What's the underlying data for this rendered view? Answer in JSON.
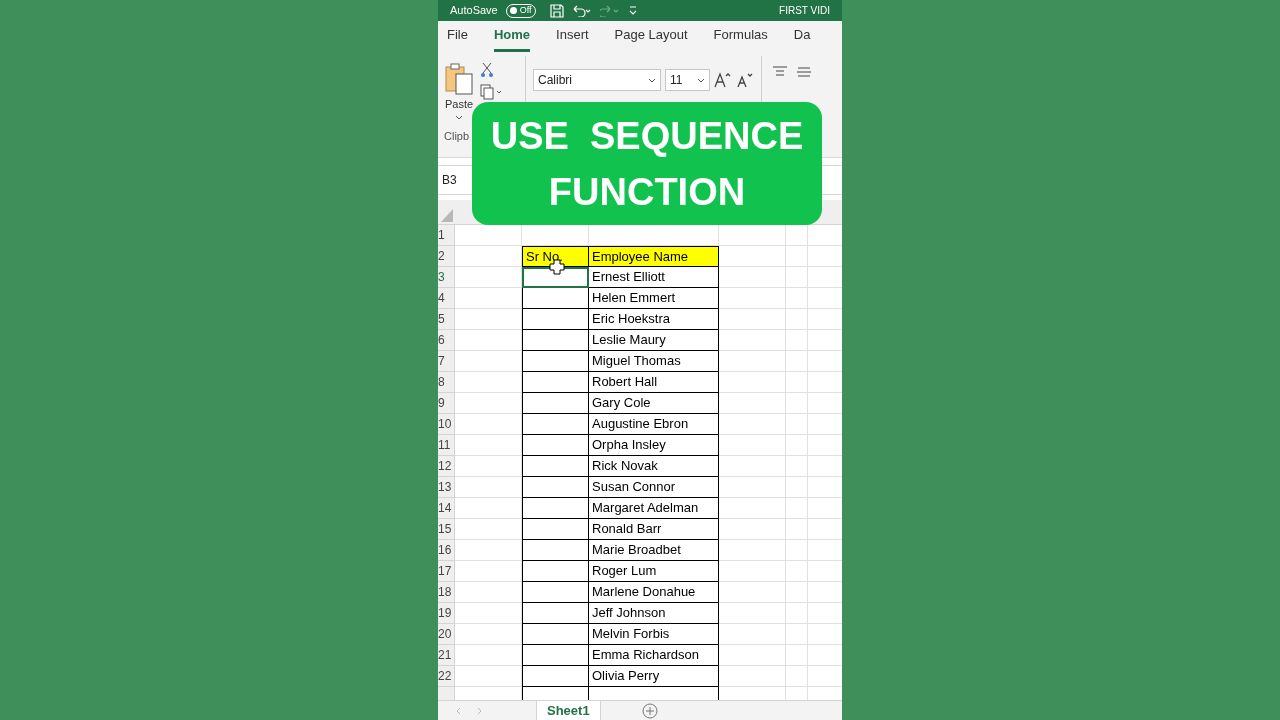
{
  "title_bar": {
    "autosave_label": "AutoSave",
    "autosave_toggle": {
      "label": "Off",
      "on": false
    },
    "document_title": "FIRST VIDI"
  },
  "ribbon_tabs": [
    {
      "label": "File",
      "selected": false
    },
    {
      "label": "Home",
      "selected": true
    },
    {
      "label": "Insert",
      "selected": false
    },
    {
      "label": "Page Layout",
      "selected": false
    },
    {
      "label": "Formulas",
      "selected": false
    },
    {
      "label": "Da",
      "selected": false
    }
  ],
  "ribbon": {
    "paste_label": "Paste",
    "group_label": "Clipb",
    "font": "Calibri",
    "font_size": "11"
  },
  "name_box": "B3",
  "overlay": {
    "lines": [
      "USE  SEQUENCE",
      "FUNCTION"
    ]
  },
  "sheet": {
    "first_row": {
      "number": "1"
    },
    "header_row": {
      "number": "2",
      "sr_no": "Sr No.",
      "name": "Employee Name"
    },
    "rows": [
      {
        "number": "3",
        "name": "Ernest Elliott",
        "selected": true
      },
      {
        "number": "4",
        "name": "Helen Emmert",
        "selected": false
      },
      {
        "number": "5",
        "name": "Eric Hoekstra",
        "selected": false
      },
      {
        "number": "6",
        "name": "Leslie Maury",
        "selected": false
      },
      {
        "number": "7",
        "name": "Miguel Thomas",
        "selected": false
      },
      {
        "number": "8",
        "name": "Robert Hall",
        "selected": false
      },
      {
        "number": "9",
        "name": "Gary Cole",
        "selected": false
      },
      {
        "number": "10",
        "name": "Augustine Ebron",
        "selected": false
      },
      {
        "number": "11",
        "name": "Orpha Insley",
        "selected": false
      },
      {
        "number": "12",
        "name": "Rick Novak",
        "selected": false
      },
      {
        "number": "13",
        "name": "Susan Connor",
        "selected": false
      },
      {
        "number": "14",
        "name": "Margaret Adelman",
        "selected": false
      },
      {
        "number": "15",
        "name": "Ronald Barr",
        "selected": false
      },
      {
        "number": "16",
        "name": "Marie Broadbet",
        "selected": false
      },
      {
        "number": "17",
        "name": "Roger Lum",
        "selected": false
      },
      {
        "number": "18",
        "name": "Marlene Donahue",
        "selected": false
      },
      {
        "number": "19",
        "name": "Jeff Johnson",
        "selected": false
      },
      {
        "number": "20",
        "name": "Melvin Forbis",
        "selected": false
      },
      {
        "number": "21",
        "name": "Emma Richardson",
        "selected": false
      },
      {
        "number": "22",
        "name": "Olivia Perry",
        "selected": false
      }
    ]
  },
  "sheet_tabs": [
    {
      "label": "Sheet1",
      "selected": true
    }
  ]
}
